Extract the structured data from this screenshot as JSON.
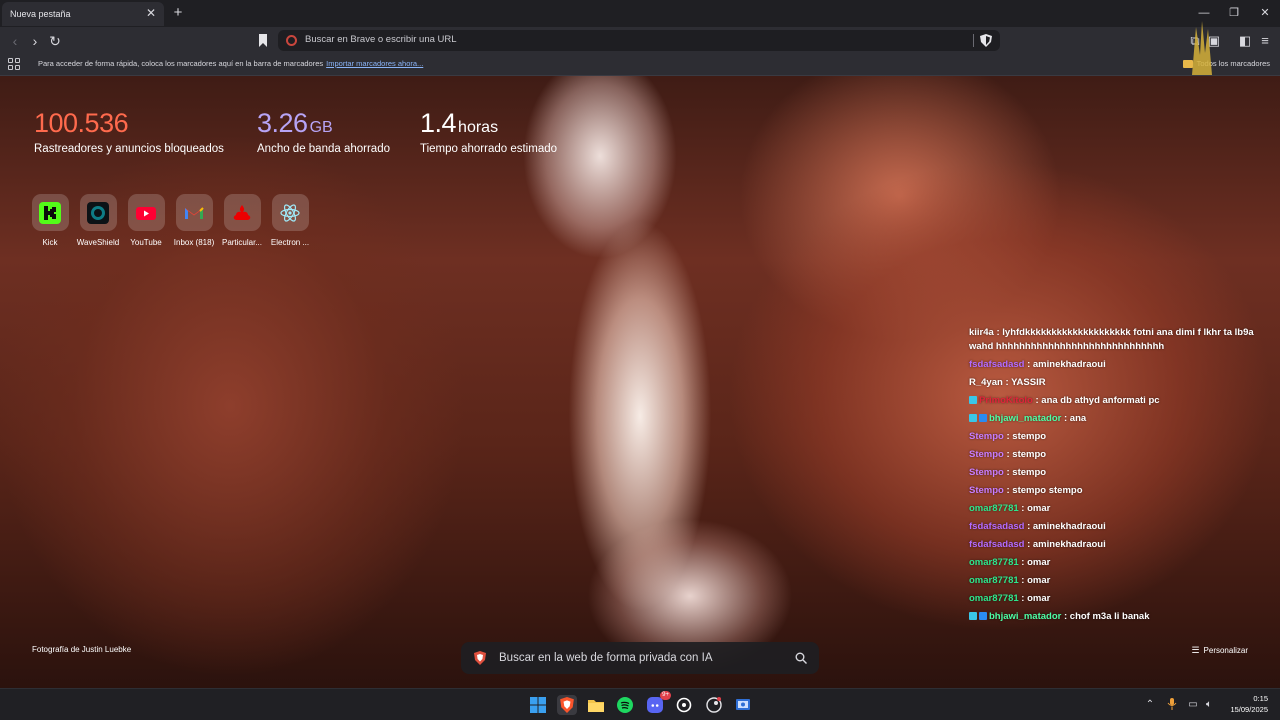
{
  "tab": {
    "title": "Nueva pestaña"
  },
  "omnibox": {
    "placeholder": "Buscar en Brave o escribir una URL"
  },
  "bookmarks_bar": {
    "hint": "Para acceder de forma rápida, coloca los marcadores aquí en la barra de marcadores",
    "import_link": "Importar marcadores ahora...",
    "all_bookmarks": "Todos los marcadores"
  },
  "stats": {
    "trackers": {
      "value": "100.536",
      "label": "Rastreadores y anuncios bloqueados",
      "color": "#ff6a4d"
    },
    "bandwidth": {
      "value": "3.26",
      "unit": "GB",
      "label": "Ancho de banda ahorrado",
      "color": "#b7a4f5"
    },
    "time": {
      "value": "1.4",
      "unit": "horas",
      "label": "Tiempo ahorrado estimado",
      "color": "#ffffff"
    }
  },
  "top_sites": [
    {
      "label": "Kick",
      "icon": "kick-icon"
    },
    {
      "label": "WaveShield",
      "icon": "waveshield-icon"
    },
    {
      "label": "YouTube",
      "icon": "youtube-icon"
    },
    {
      "label": "Inbox (818)",
      "icon": "gmail-icon"
    },
    {
      "label": "Particular...",
      "icon": "santander-icon"
    },
    {
      "label": "Electron ...",
      "icon": "electron-icon"
    }
  ],
  "chat": [
    {
      "user": "kiir4a",
      "color": "#ffffff",
      "text": "lyhfdkkkkkkkkkkkkkkkkkkkk fotni ana dimi f lkhr ta lb9a wahd hhhhhhhhhhhhhhhhhhhhhhhhhhhhh",
      "badges": 0
    },
    {
      "user": "fsdafsadasd",
      "color": "#b36bff",
      "text": "aminekhadraoui",
      "badges": 0
    },
    {
      "user": "R_4yan",
      "color": "#ffffff",
      "text": "YASSIR",
      "badges": 0
    },
    {
      "user": "PrimoKitolo",
      "color": "#e0243a",
      "text": "ana db athyd anformati pc",
      "badges": 1
    },
    {
      "user": "bhjawi_matador",
      "color": "#4dffa6",
      "text": "ana",
      "badges": 2
    },
    {
      "user": "Stempo",
      "color": "#c77dff",
      "text": "stempo",
      "badges": 0
    },
    {
      "user": "Stempo",
      "color": "#c77dff",
      "text": "stempo",
      "badges": 0
    },
    {
      "user": "Stempo",
      "color": "#c77dff",
      "text": "stempo",
      "badges": 0
    },
    {
      "user": "Stempo",
      "color": "#c77dff",
      "text": "stempo stempo",
      "badges": 0
    },
    {
      "user": "omar87781",
      "color": "#2ee68c",
      "text": "omar",
      "badges": 0
    },
    {
      "user": "fsdafsadasd",
      "color": "#b36bff",
      "text": "aminekhadraoui",
      "badges": 0
    },
    {
      "user": "fsdafsadasd",
      "color": "#b36bff",
      "text": "aminekhadraoui",
      "badges": 0
    },
    {
      "user": "omar87781",
      "color": "#2ee68c",
      "text": "omar",
      "badges": 0
    },
    {
      "user": "omar87781",
      "color": "#2ee68c",
      "text": "omar",
      "badges": 0
    },
    {
      "user": "omar87781",
      "color": "#2ee68c",
      "text": "omar",
      "badges": 0
    },
    {
      "user": "bhjawi_matador",
      "color": "#4dffa6",
      "text": "chof m3a li banak",
      "badges": 2
    }
  ],
  "photo_credit": "Fotografía de Justin Luebke",
  "customize": "Personalizar",
  "search": {
    "placeholder": "Buscar en la web de forma privada con IA"
  },
  "taskbar": {
    "apps": [
      "windows-start-icon",
      "brave-icon",
      "file-explorer-icon",
      "spotify-icon",
      "discord-icon",
      "app-icon",
      "steam-icon",
      "app-manager-icon"
    ],
    "discord_badge": "9+",
    "time": "0:15",
    "date": "15/09/2025"
  }
}
